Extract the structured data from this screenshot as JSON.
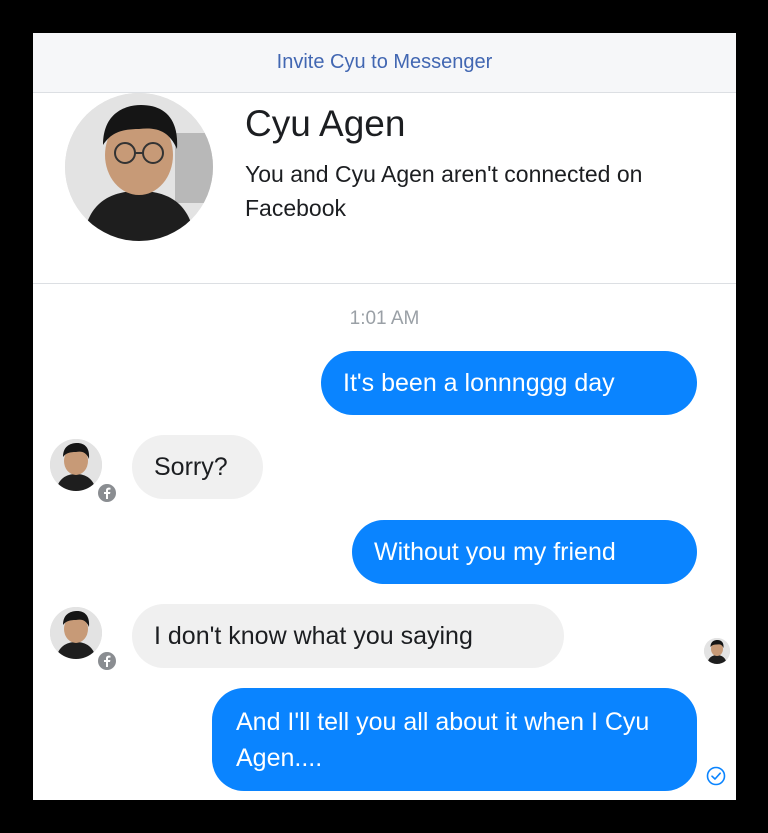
{
  "header": {
    "invite_label": "Invite Cyu to Messenger"
  },
  "profile": {
    "name": "Cyu Agen",
    "subtitle": "You and Cyu Agen aren't connected on Facebook"
  },
  "conversation": {
    "timestamp": "1:01 AM",
    "messages": [
      {
        "from": "me",
        "text": "It's been a lonnnggg day"
      },
      {
        "from": "them",
        "text": "Sorry?"
      },
      {
        "from": "me",
        "text": "Without you my friend"
      },
      {
        "from": "them",
        "text": "I don't know what you saying"
      },
      {
        "from": "me",
        "text": "And I'll tell you all about it when I Cyu Agen...."
      }
    ]
  },
  "colors": {
    "outgoing_bubble": "#0a84ff",
    "incoming_bubble": "#f0f0f0",
    "link": "#4267b2"
  },
  "icons": [
    "facebook-badge-icon",
    "sent-check-icon"
  ]
}
